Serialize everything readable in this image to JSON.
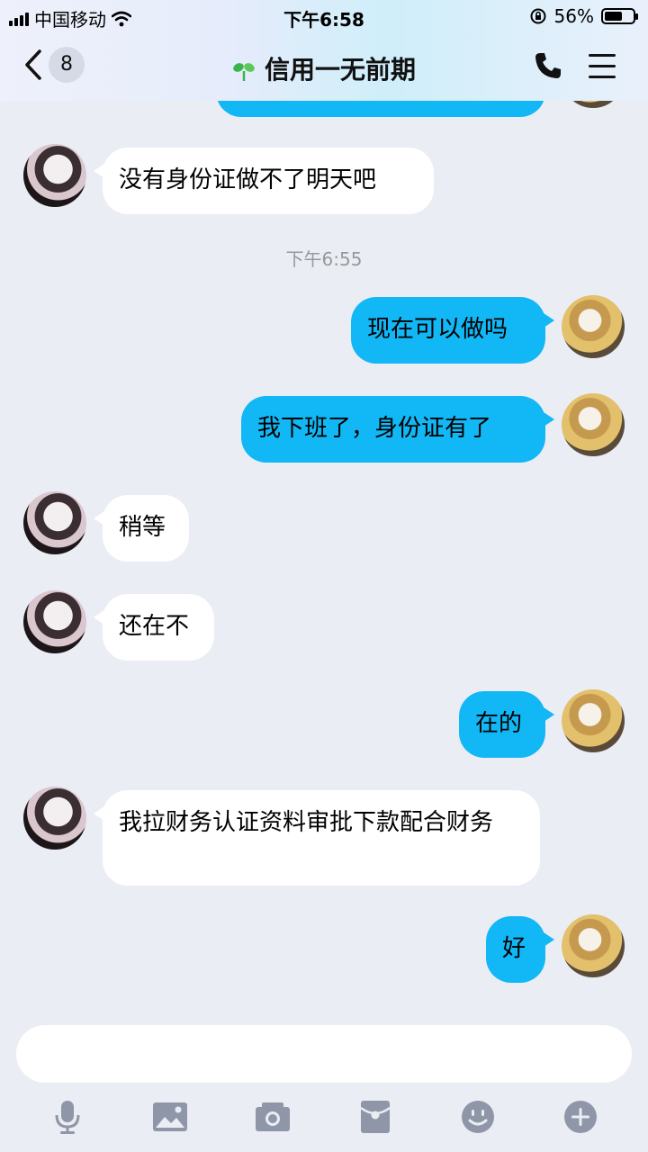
{
  "status_bar": {
    "carrier": "中国移动",
    "time": "下午6:58",
    "battery_percent": "56%",
    "battery_level": 0.56
  },
  "header": {
    "back_badge": "8",
    "title": "信用一无前期",
    "icons": [
      "back-chevron-icon",
      "sprout-icon",
      "phone-icon",
      "menu-icon"
    ]
  },
  "chat": {
    "timestamp": "下午6:55",
    "messages": [
      {
        "from": "other",
        "text": "没有身份证做不了明天吧"
      },
      {
        "from": "me",
        "text": "现在可以做吗"
      },
      {
        "from": "me",
        "text": "我下班了，身份证有了"
      },
      {
        "from": "other",
        "text": "稍等"
      },
      {
        "from": "other",
        "text": "还在不"
      },
      {
        "from": "me",
        "text": "在的"
      },
      {
        "from": "other",
        "text": "我拉财务认证资料审批下款配合财务"
      },
      {
        "from": "me",
        "text": "好"
      }
    ]
  },
  "input": {
    "value": "",
    "placeholder": ""
  },
  "toolbar": {
    "icons": [
      "microphone-icon",
      "image-icon",
      "camera-icon",
      "red-packet-icon",
      "emoji-icon",
      "plus-icon"
    ]
  },
  "colors": {
    "accent": "#12b7f5",
    "background": "#ebedf5",
    "bubble_left": "#ffffff",
    "icon_gray": "#8f96a8"
  }
}
